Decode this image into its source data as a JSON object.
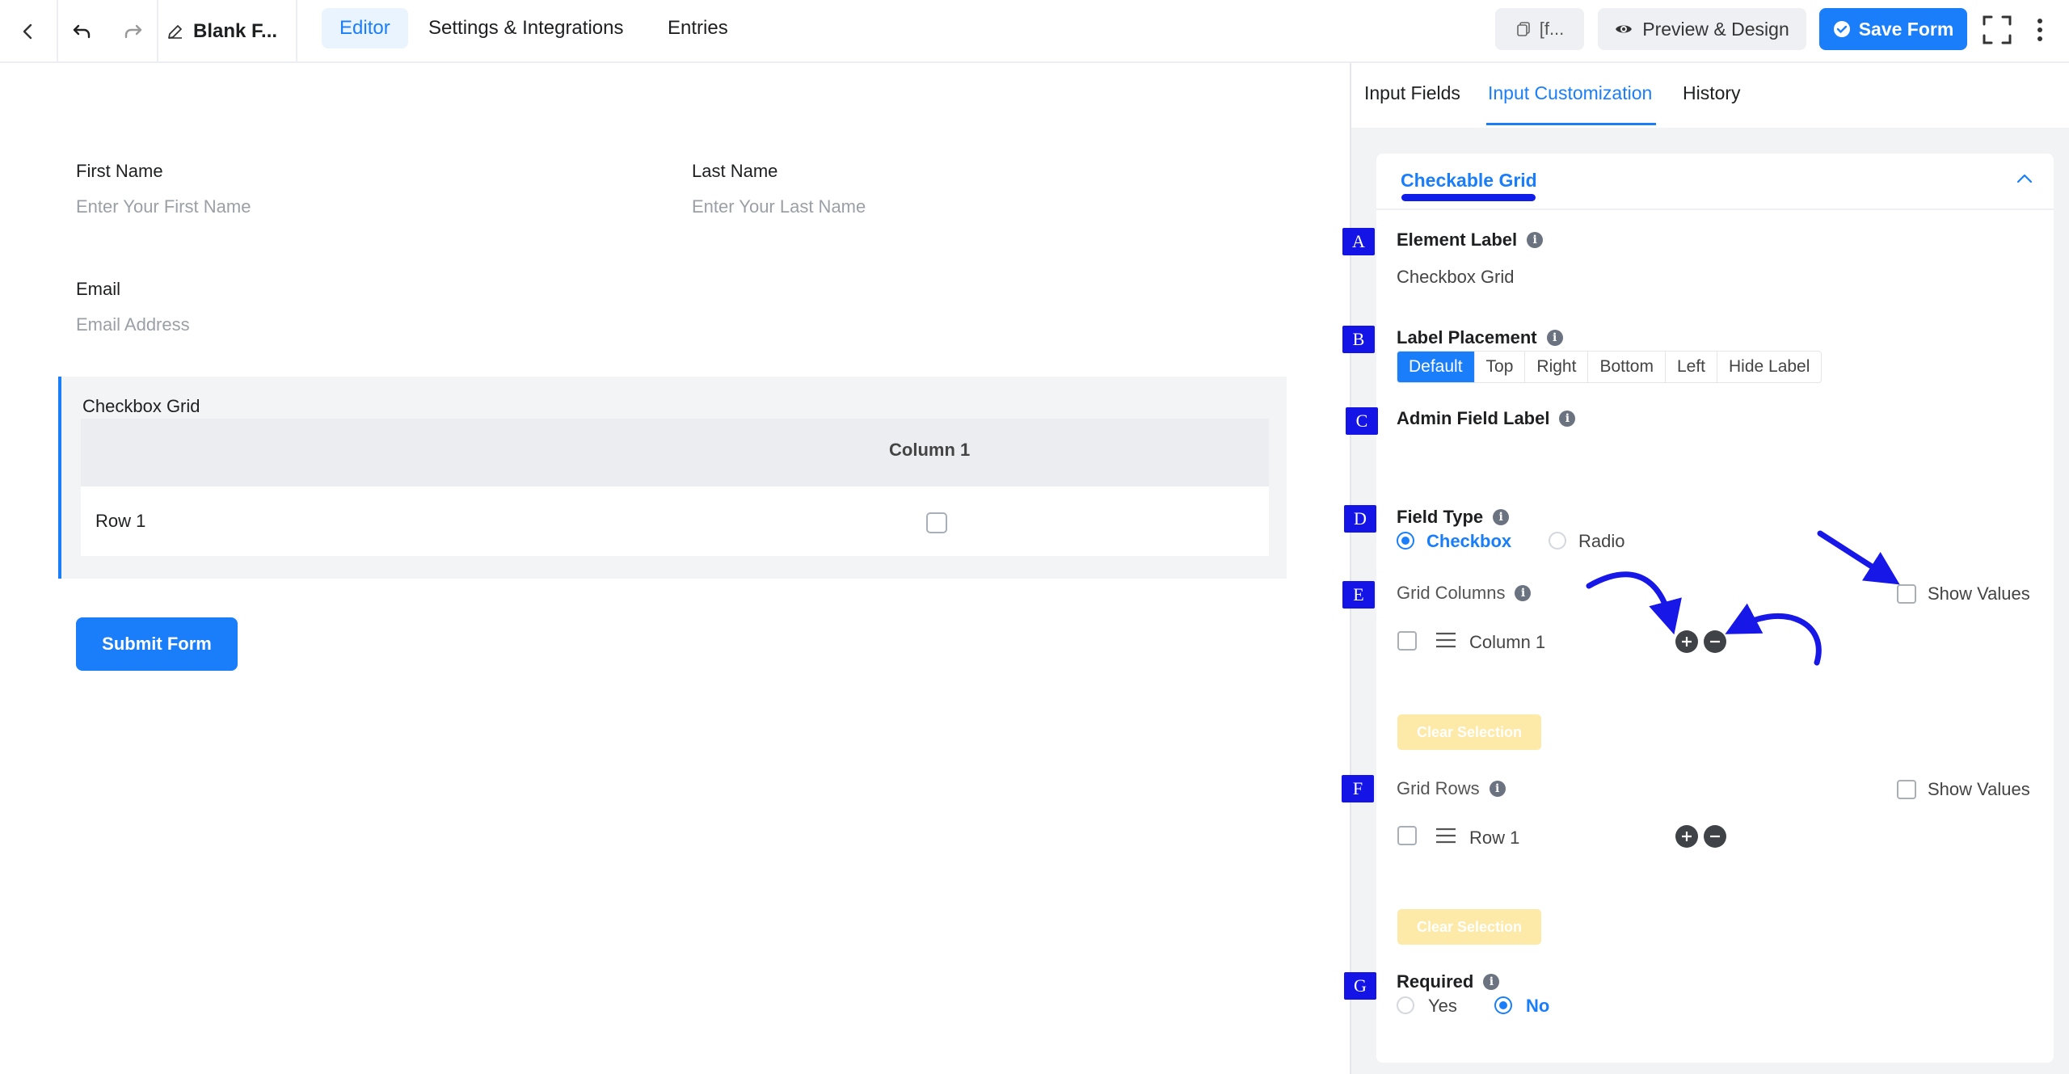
{
  "topbar": {
    "form_name": "Blank F...",
    "tabs": [
      {
        "label": "Editor",
        "active": true
      },
      {
        "label": "Settings & Integrations",
        "active": false
      },
      {
        "label": "Entries",
        "active": false
      }
    ],
    "shortcode_label": "[f...",
    "preview_label": "Preview & Design",
    "save_label": "Save Form",
    "accent_color": "#1a7efb"
  },
  "form": {
    "first_name": {
      "label": "First Name",
      "placeholder": "Enter Your First Name"
    },
    "last_name": {
      "label": "Last Name",
      "placeholder": "Enter Your Last Name"
    },
    "email": {
      "label": "Email",
      "placeholder": "Email Address"
    },
    "grid": {
      "label": "Checkbox Grid",
      "column": "Column 1",
      "row": "Row 1"
    },
    "submit_label": "Submit Form"
  },
  "panel": {
    "tabs": [
      {
        "label": "Input Fields",
        "active": false
      },
      {
        "label": "Input Customization",
        "active": true
      },
      {
        "label": "History",
        "active": false
      }
    ],
    "section_title": "Checkable Grid",
    "element_label": {
      "title": "Element Label",
      "value": "Checkbox Grid"
    },
    "label_placement": {
      "title": "Label Placement",
      "options": [
        "Default",
        "Top",
        "Right",
        "Bottom",
        "Left",
        "Hide Label"
      ],
      "selected": "Default"
    },
    "admin_field_label": {
      "title": "Admin Field Label"
    },
    "field_type": {
      "title": "Field Type",
      "options": [
        "Checkbox",
        "Radio"
      ],
      "selected": "Checkbox"
    },
    "grid_columns": {
      "title": "Grid Columns",
      "show_values": "Show Values",
      "items": [
        "Column 1"
      ],
      "clear_label": "Clear Selection"
    },
    "grid_rows": {
      "title": "Grid Rows",
      "show_values": "Show Values",
      "items": [
        "Row 1"
      ],
      "clear_label": "Clear Selection"
    },
    "required": {
      "title": "Required",
      "options": [
        "Yes",
        "No"
      ],
      "selected": "No"
    }
  },
  "annotations": {
    "badges": [
      "A",
      "B",
      "C",
      "D",
      "E",
      "F",
      "G"
    ],
    "badge_color": "#1414e6",
    "arrow_color": "#1717e8"
  }
}
